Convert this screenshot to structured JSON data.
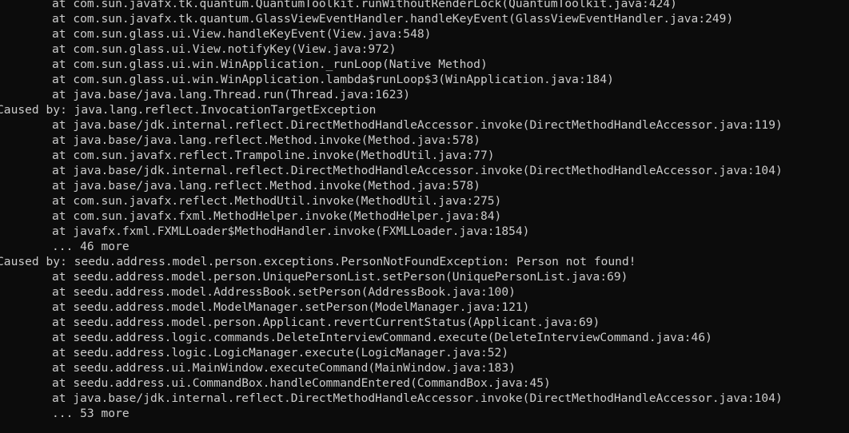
{
  "terminal": {
    "colors": {
      "background": "#0c0c0c",
      "text": "#cccccc"
    },
    "lines": [
      {
        "type": "frame",
        "text": "at com.sun.javafx.tk.quantum.QuantumToolkit.runWithoutRenderLock(QuantumToolkit.java:424)"
      },
      {
        "type": "frame",
        "text": "at com.sun.javafx.tk.quantum.GlassViewEventHandler.handleKeyEvent(GlassViewEventHandler.java:249)"
      },
      {
        "type": "frame",
        "text": "at com.sun.glass.ui.View.handleKeyEvent(View.java:548)"
      },
      {
        "type": "frame",
        "text": "at com.sun.glass.ui.View.notifyKey(View.java:972)"
      },
      {
        "type": "frame",
        "text": "at com.sun.glass.ui.win.WinApplication._runLoop(Native Method)"
      },
      {
        "type": "frame",
        "text": "at com.sun.glass.ui.win.WinApplication.lambda$runLoop$3(WinApplication.java:184)"
      },
      {
        "type": "frame",
        "text": "at java.base/java.lang.Thread.run(Thread.java:1623)"
      },
      {
        "type": "caused",
        "text": "Caused by: java.lang.reflect.InvocationTargetException"
      },
      {
        "type": "frame",
        "text": "at java.base/jdk.internal.reflect.DirectMethodHandleAccessor.invoke(DirectMethodHandleAccessor.java:119)"
      },
      {
        "type": "frame",
        "text": "at java.base/java.lang.reflect.Method.invoke(Method.java:578)"
      },
      {
        "type": "frame",
        "text": "at com.sun.javafx.reflect.Trampoline.invoke(MethodUtil.java:77)"
      },
      {
        "type": "frame",
        "text": "at java.base/jdk.internal.reflect.DirectMethodHandleAccessor.invoke(DirectMethodHandleAccessor.java:104)"
      },
      {
        "type": "frame",
        "text": "at java.base/java.lang.reflect.Method.invoke(Method.java:578)"
      },
      {
        "type": "frame",
        "text": "at com.sun.javafx.reflect.MethodUtil.invoke(MethodUtil.java:275)"
      },
      {
        "type": "frame",
        "text": "at com.sun.javafx.fxml.MethodHelper.invoke(MethodHelper.java:84)"
      },
      {
        "type": "frame",
        "text": "at javafx.fxml.FXMLLoader$MethodHandler.invoke(FXMLLoader.java:1854)"
      },
      {
        "type": "more",
        "text": "... 46 more"
      },
      {
        "type": "caused",
        "text": "Caused by: seedu.address.model.person.exceptions.PersonNotFoundException: Person not found!"
      },
      {
        "type": "frame",
        "text": "at seedu.address.model.person.UniquePersonList.setPerson(UniquePersonList.java:69)"
      },
      {
        "type": "frame",
        "text": "at seedu.address.model.AddressBook.setPerson(AddressBook.java:100)"
      },
      {
        "type": "frame",
        "text": "at seedu.address.model.ModelManager.setPerson(ModelManager.java:121)"
      },
      {
        "type": "frame",
        "text": "at seedu.address.model.person.Applicant.revertCurrentStatus(Applicant.java:69)"
      },
      {
        "type": "frame",
        "text": "at seedu.address.logic.commands.DeleteInterviewCommand.execute(DeleteInterviewCommand.java:46)"
      },
      {
        "type": "frame",
        "text": "at seedu.address.logic.LogicManager.execute(LogicManager.java:52)"
      },
      {
        "type": "frame",
        "text": "at seedu.address.ui.MainWindow.executeCommand(MainWindow.java:183)"
      },
      {
        "type": "frame",
        "text": "at seedu.address.ui.CommandBox.handleCommandEntered(CommandBox.java:45)"
      },
      {
        "type": "frame",
        "text": "at java.base/jdk.internal.reflect.DirectMethodHandleAccessor.invoke(DirectMethodHandleAccessor.java:104)"
      },
      {
        "type": "more",
        "text": "... 53 more"
      }
    ]
  }
}
